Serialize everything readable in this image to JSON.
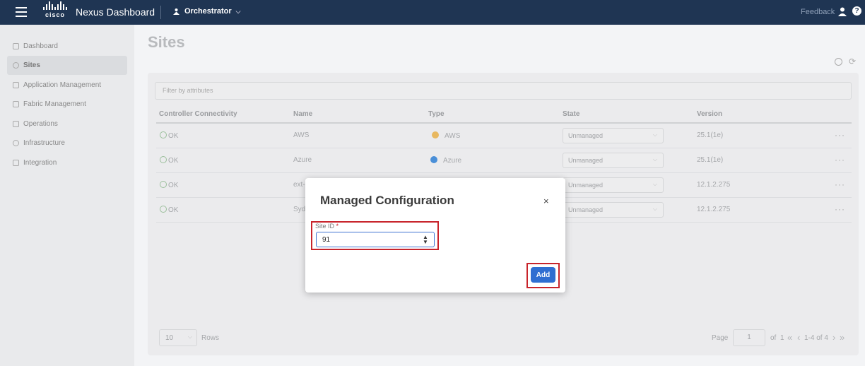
{
  "topbar": {
    "brand_word": "cisco",
    "app_title": "Nexus Dashboard",
    "service": "Orchestrator",
    "feedback": "Feedback",
    "help_glyph": "?"
  },
  "sidebar": {
    "items": [
      {
        "label": "Dashboard",
        "icon": "dashboard-icon",
        "active": false
      },
      {
        "label": "Sites",
        "icon": "globe-icon",
        "active": true
      },
      {
        "label": "Application Management",
        "icon": "app-icon",
        "active": false
      },
      {
        "label": "Fabric Management",
        "icon": "fabric-icon",
        "active": false
      },
      {
        "label": "Operations",
        "icon": "operations-icon",
        "active": false
      },
      {
        "label": "Infrastructure",
        "icon": "infrastructure-icon",
        "active": false
      },
      {
        "label": "Integration",
        "icon": "integration-icon",
        "active": false
      }
    ]
  },
  "page": {
    "title": "Sites"
  },
  "table": {
    "filter_placeholder": "Filter by attributes",
    "columns": [
      "Controller Connectivity",
      "Name",
      "Type",
      "State",
      "Version"
    ],
    "rows": [
      {
        "connectivity": "OK",
        "name": "AWS",
        "type": "AWS",
        "type_color": "#e8b860",
        "state": "Unmanaged",
        "version": "25.1(1e)"
      },
      {
        "connectivity": "OK",
        "name": "Azure",
        "type": "Azure",
        "type_color": "#4a8fd8",
        "state": "Unmanaged",
        "version": "25.1(1e)"
      },
      {
        "connectivity": "OK",
        "name": "ext-",
        "type": "",
        "type_color": "",
        "state": "Unmanaged",
        "version": "12.1.2.275"
      },
      {
        "connectivity": "OK",
        "name": "Syd",
        "type": "",
        "type_color": "",
        "state": "Unmanaged",
        "version": "12.1.2.275"
      }
    ],
    "more_glyph": "···"
  },
  "pagination": {
    "rows_value": "10",
    "rows_label": "Rows",
    "page_label": "Page",
    "page_value": "1",
    "of_label": "of",
    "total_pages": "1",
    "range": "1-4 of 4"
  },
  "modal": {
    "title": "Managed Configuration",
    "close_glyph": "×",
    "field_label": "Site ID",
    "required_mark": "*",
    "site_id_value": "91",
    "add_label": "Add"
  },
  "colors": {
    "topbar": "#1f3553",
    "primary": "#2f6ed1",
    "highlight": "#c8242b"
  }
}
